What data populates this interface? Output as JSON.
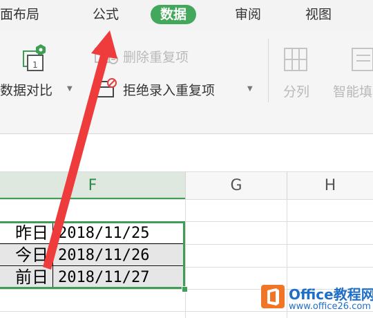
{
  "menu": {
    "tabs": [
      {
        "label": "面布局"
      },
      {
        "label": "公式"
      },
      {
        "label": "数据"
      },
      {
        "label": "审阅"
      },
      {
        "label": "视图"
      }
    ]
  },
  "ribbon": {
    "compare_label": "数据对比",
    "remove_dup_label": "删除重复项",
    "reject_dup_label": "拒绝录入重复项",
    "split_label": "分列",
    "smart_label": "智能填"
  },
  "sheet": {
    "columns": [
      "F",
      "G",
      "H"
    ],
    "rows": [
      {
        "label": "昨日",
        "date": "2018/11/25"
      },
      {
        "label": "今日",
        "date": "2018/11/26"
      },
      {
        "label": "前日",
        "date": "2018/11/27"
      }
    ]
  },
  "watermark": {
    "title": "Office教程网",
    "url": "www.office26.com",
    "badge_color": "#f07526",
    "text_color": "#1f6ec7"
  },
  "colors": {
    "active_tab": "#44a85c",
    "selection": "#3f9e55",
    "arrow": "#ee3b3b"
  }
}
